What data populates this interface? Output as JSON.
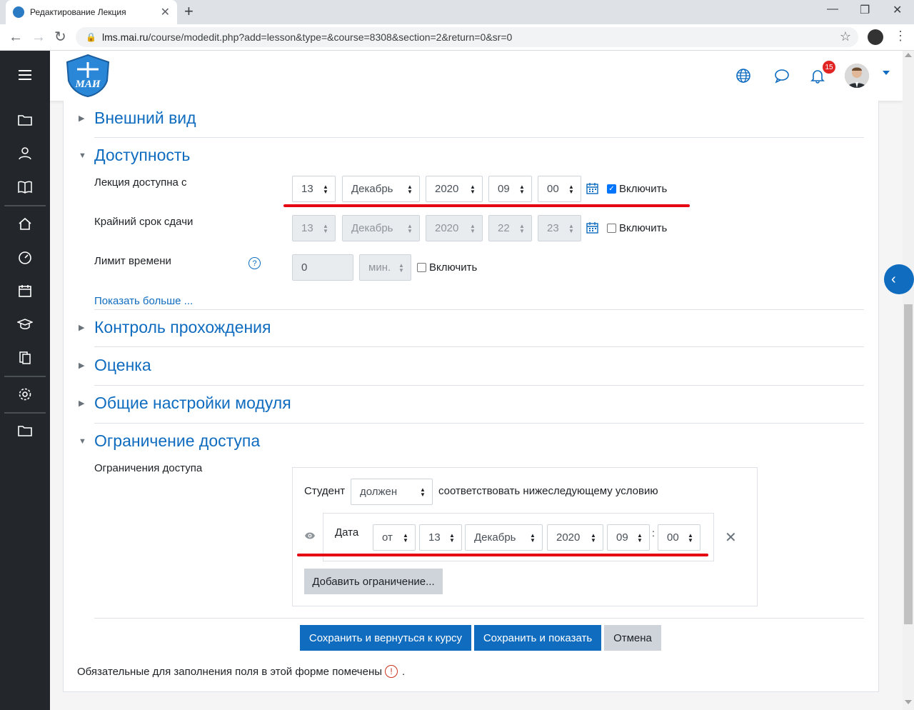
{
  "browser": {
    "tab_title": "Редактирование Лекция",
    "url_host": "lms.mai.ru",
    "url_path": "/course/modedit.php?add=lesson&type=&course=8308&section=2&return=0&sr=0"
  },
  "header": {
    "notification_count": "15"
  },
  "sections": {
    "appearance": "Внешний вид",
    "availability": "Доступность",
    "flow_control": "Контроль прохождения",
    "grade": "Оценка",
    "common_module": "Общие настройки модуля",
    "restrict_access": "Ограничение доступа"
  },
  "availability": {
    "available_from": {
      "label": "Лекция доступна с",
      "day": "13",
      "month": "Декабрь",
      "year": "2020",
      "hour": "09",
      "minute": "00",
      "enable_label": "Включить",
      "enabled": true
    },
    "deadline": {
      "label": "Крайний срок сдачи",
      "day": "13",
      "month": "Декабрь",
      "year": "2020",
      "hour": "22",
      "minute": "23",
      "enable_label": "Включить",
      "enabled": false
    },
    "time_limit": {
      "label": "Лимит времени",
      "value": "0",
      "unit": "мин.",
      "enable_label": "Включить",
      "enabled": false
    },
    "show_more": "Показать больше ..."
  },
  "restrictions": {
    "label": "Ограничения доступа",
    "student_label": "Студент",
    "must_value": "должен",
    "condition_text": "соответствовать нижеследующему условию",
    "date_label": "Дата",
    "direction": "от",
    "day": "13",
    "month": "Декабрь",
    "year": "2020",
    "hour": "09",
    "colon": ":",
    "minute": "00",
    "add_button": "Добавить ограничение..."
  },
  "buttons": {
    "save_return": "Сохранить и вернуться к курсу",
    "save_show": "Сохранить и показать",
    "cancel": "Отмена"
  },
  "footer_note": "Обязательные для заполнения поля в этой форме помечены",
  "footer_period": ".",
  "colors": {
    "accent": "#0f6cbf",
    "sidebar": "#23272b",
    "annotation": "#e50012"
  }
}
